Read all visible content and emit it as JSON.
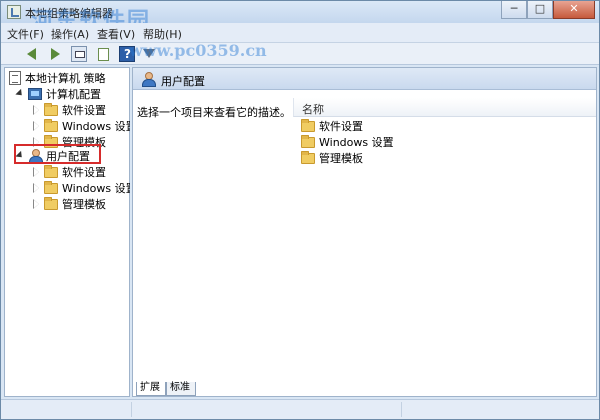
{
  "window": {
    "title": "本地组策略编辑器",
    "watermark": "河东软件园",
    "watermark_url": "www.pc0359.cn"
  },
  "controls": {
    "minimize": "─",
    "maximize": "□",
    "close": "✕"
  },
  "menu": {
    "items": [
      {
        "label": "文件(F)"
      },
      {
        "label": "操作(A)"
      },
      {
        "label": "查看(V)"
      },
      {
        "label": "帮助(H)"
      }
    ]
  },
  "toolbar": {
    "buttons": [
      "back-icon",
      "forward-icon",
      "up-level-icon",
      "show-hide-tree-icon",
      "help-icon",
      "filter-icon"
    ]
  },
  "tree": {
    "root": "本地计算机 策略",
    "computer_config": "计算机配置",
    "computer_children": [
      "软件设置",
      "Windows 设置",
      "管理模板"
    ],
    "user_config": "用户配置",
    "user_children": [
      "软件设置",
      "Windows 设置",
      "管理模板"
    ]
  },
  "detail": {
    "title": "用户配置",
    "description": "选择一个项目来查看它的描述。",
    "column_name": "名称",
    "items": [
      "软件设置",
      "Windows 设置",
      "管理模板"
    ]
  },
  "tabs": {
    "extended": "扩展",
    "standard": "标准"
  },
  "colors": {
    "highlight_box": "#d62b2b",
    "accent": "#3f78c3"
  }
}
